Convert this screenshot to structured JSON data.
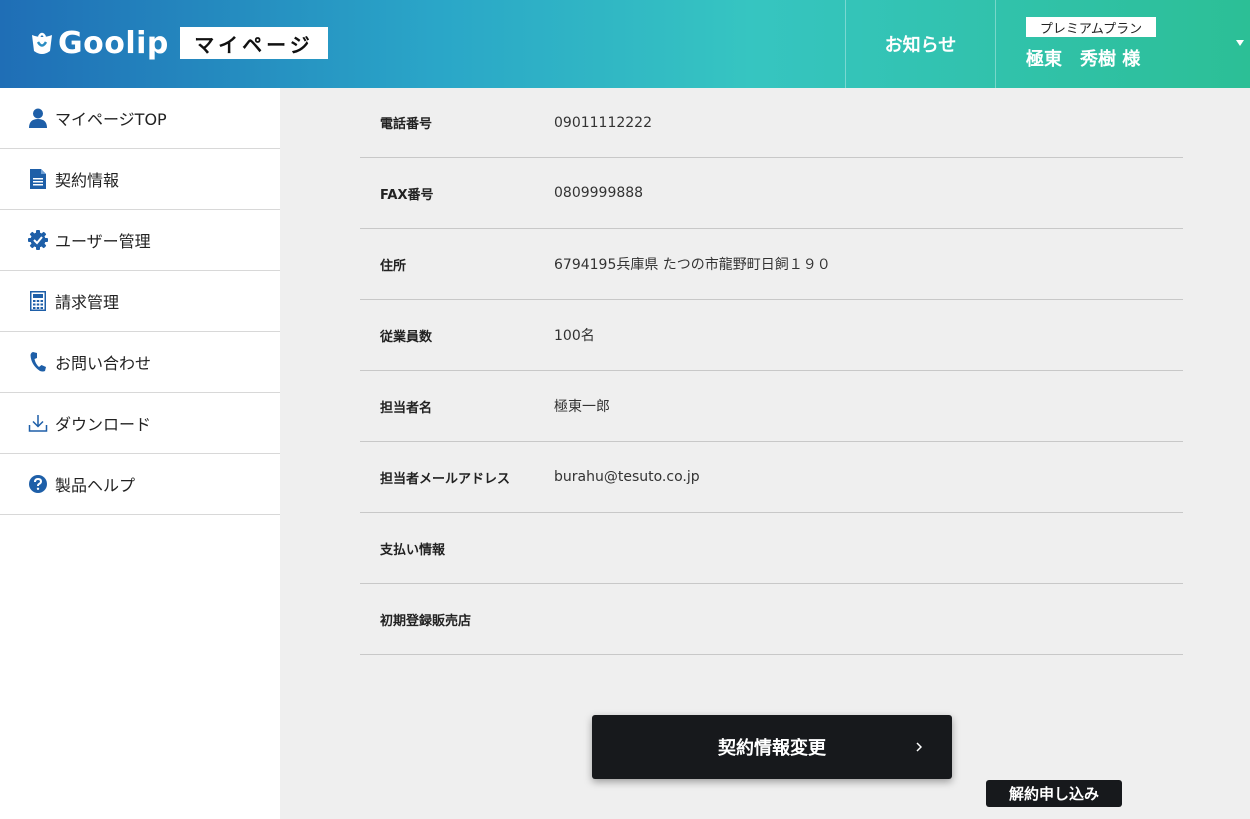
{
  "header": {
    "logo_text": "Goolip",
    "page_badge": "マイページ",
    "notice_label": "お知らせ",
    "plan_label": "プレミアムプラン",
    "user_name": "極東　秀樹 様"
  },
  "sidebar": {
    "items": [
      {
        "label": "マイページTOP",
        "icon": "user-icon"
      },
      {
        "label": "契約情報",
        "icon": "document-icon"
      },
      {
        "label": "ユーザー管理",
        "icon": "gear-check-icon"
      },
      {
        "label": "請求管理",
        "icon": "calculator-icon"
      },
      {
        "label": "お問い合わせ",
        "icon": "phone-icon"
      },
      {
        "label": "ダウンロード",
        "icon": "download-icon"
      },
      {
        "label": "製品ヘルプ",
        "icon": "help-icon"
      }
    ]
  },
  "contract": {
    "rows": [
      {
        "label": "電話番号",
        "value": "09011112222"
      },
      {
        "label": "FAX番号",
        "value": "0809999888"
      },
      {
        "label": "住所",
        "value": "6794195兵庫県 たつの市龍野町日飼１９０"
      },
      {
        "label": "従業員数",
        "value": "100名"
      },
      {
        "label": "担当者名",
        "value": "極東一郎"
      },
      {
        "label": "担当者メールアドレス",
        "value": "burahu@tesuto.co.jp"
      },
      {
        "label": "支払い情報",
        "value": ""
      },
      {
        "label": "初期登録販売店",
        "value": ""
      }
    ]
  },
  "actions": {
    "change_label": "契約情報変更",
    "cancel_label": "解約申し込み"
  },
  "colors": {
    "accent": "#1f6eb6",
    "button_dark": "#17191c",
    "icon_blue": "#1e5fa8"
  }
}
